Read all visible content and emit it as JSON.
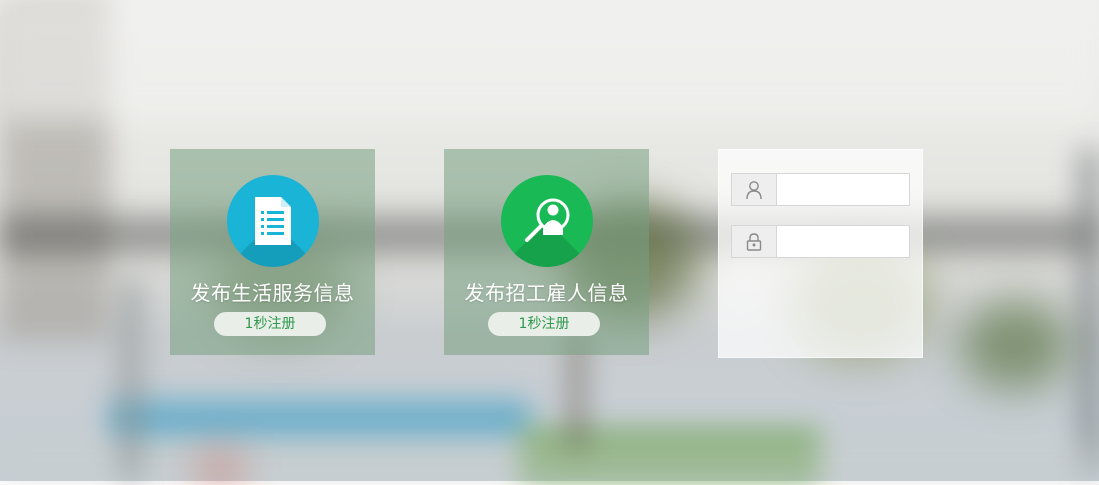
{
  "cards": [
    {
      "title": "发布生活服务信息",
      "button_label": "1秒注册",
      "icon": "document-list-icon",
      "color": "#19b4d6",
      "tile_color": "#9fb9a8"
    },
    {
      "title": "发布招工雇人信息",
      "button_label": "1秒注册",
      "icon": "person-search-icon",
      "color": "#19b955",
      "tile_color": "#9fb9a8"
    }
  ],
  "login": {
    "username": {
      "value": "",
      "placeholder": "",
      "icon": "user-icon"
    },
    "password": {
      "value": "",
      "placeholder": "",
      "icon": "lock-icon"
    }
  }
}
